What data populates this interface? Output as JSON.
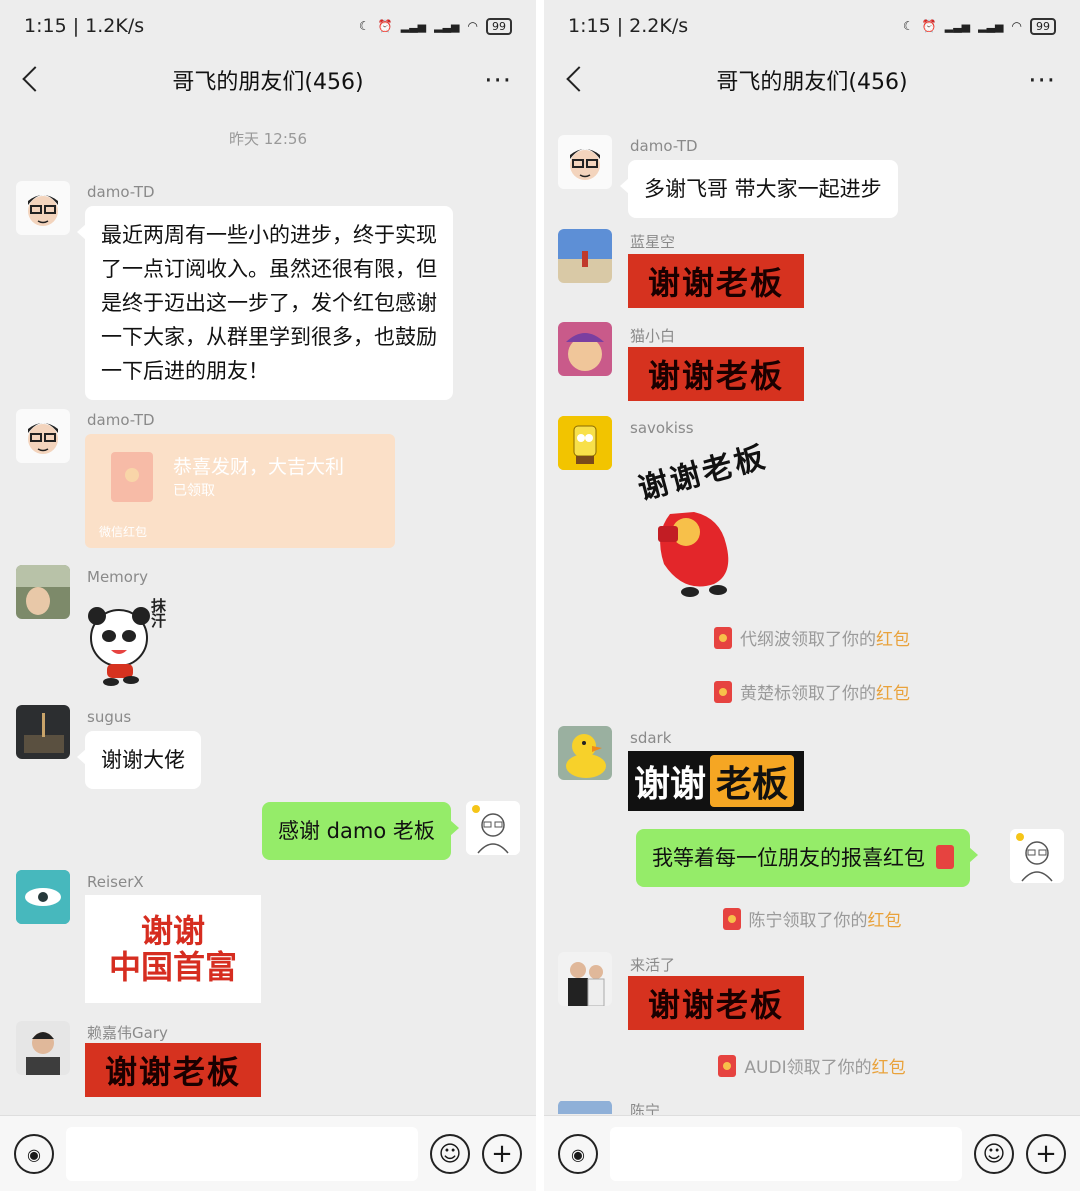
{
  "left": {
    "status": {
      "time": "1:15 | 1.2K/s",
      "battery": "99"
    },
    "header": {
      "title": "哥飞的朋友们(456)",
      "more": "···"
    },
    "timestamp": "昨天 12:56",
    "messages": [
      {
        "user": "damo-TD",
        "text": "最近两周有一些小的进步，终于实现了一点订阅收入。虽然还很有限，但是终于迈出这一步了，发个红包感谢一下大家，从群里学到很多，也鼓励一下后进的朋友！"
      },
      {
        "user": "damo-TD",
        "redpacket": {
          "title": "恭喜发财，大吉大利",
          "status": "已领取",
          "footer": "微信红包"
        }
      },
      {
        "user": "Memory",
        "sticker": "抹汗"
      },
      {
        "user": "sugus",
        "text": "谢谢大佬"
      },
      {
        "me": true,
        "text": "感谢 damo 老板"
      },
      {
        "user": "ReiserX",
        "sticker_line1": "谢谢",
        "sticker_line2": "中国首富"
      },
      {
        "user": "赖嘉伟Gary",
        "sticker": "谢谢老板"
      }
    ]
  },
  "right": {
    "status": {
      "time": "1:15 | 2.2K/s",
      "battery": "99"
    },
    "header": {
      "title": "哥飞的朋友们(456)",
      "more": "···"
    },
    "messages": [
      {
        "user": "damo-TD",
        "text": "多谢飞哥 带大家一起进步"
      },
      {
        "user": "蓝星空",
        "sticker": "谢谢老板"
      },
      {
        "user": "猫小白",
        "sticker": "谢谢老板"
      },
      {
        "user": "savokiss",
        "sticker": "谢谢老板"
      },
      {
        "system": {
          "name": "代纲波",
          "mid": "领取了你的",
          "hb": "红包"
        }
      },
      {
        "system": {
          "name": "黄楚标",
          "mid": "领取了你的",
          "hb": "红包"
        }
      },
      {
        "user": "sdark",
        "sticker_a": "谢谢",
        "sticker_b": "老板"
      },
      {
        "me": true,
        "text": "我等着每一位朋友的报喜红包"
      },
      {
        "system": {
          "name": "陈宁",
          "mid": "领取了你的",
          "hb": "红包"
        }
      },
      {
        "user": "来活了",
        "sticker": "谢谢老板"
      },
      {
        "system": {
          "name": "AUDI",
          "mid": "领取了你的",
          "hb": "红包"
        }
      },
      {
        "user": "陈宁"
      }
    ]
  },
  "icons": {
    "voice": "voice-icon",
    "emoji": "emoji-icon",
    "plus": "plus-icon"
  },
  "colors": {
    "bg": "#ededed",
    "me_bubble": "#95ec69",
    "redpacket": "#fbe0c8",
    "sticker_red": "#d6321f",
    "hongbao_text": "#e9a23b"
  }
}
